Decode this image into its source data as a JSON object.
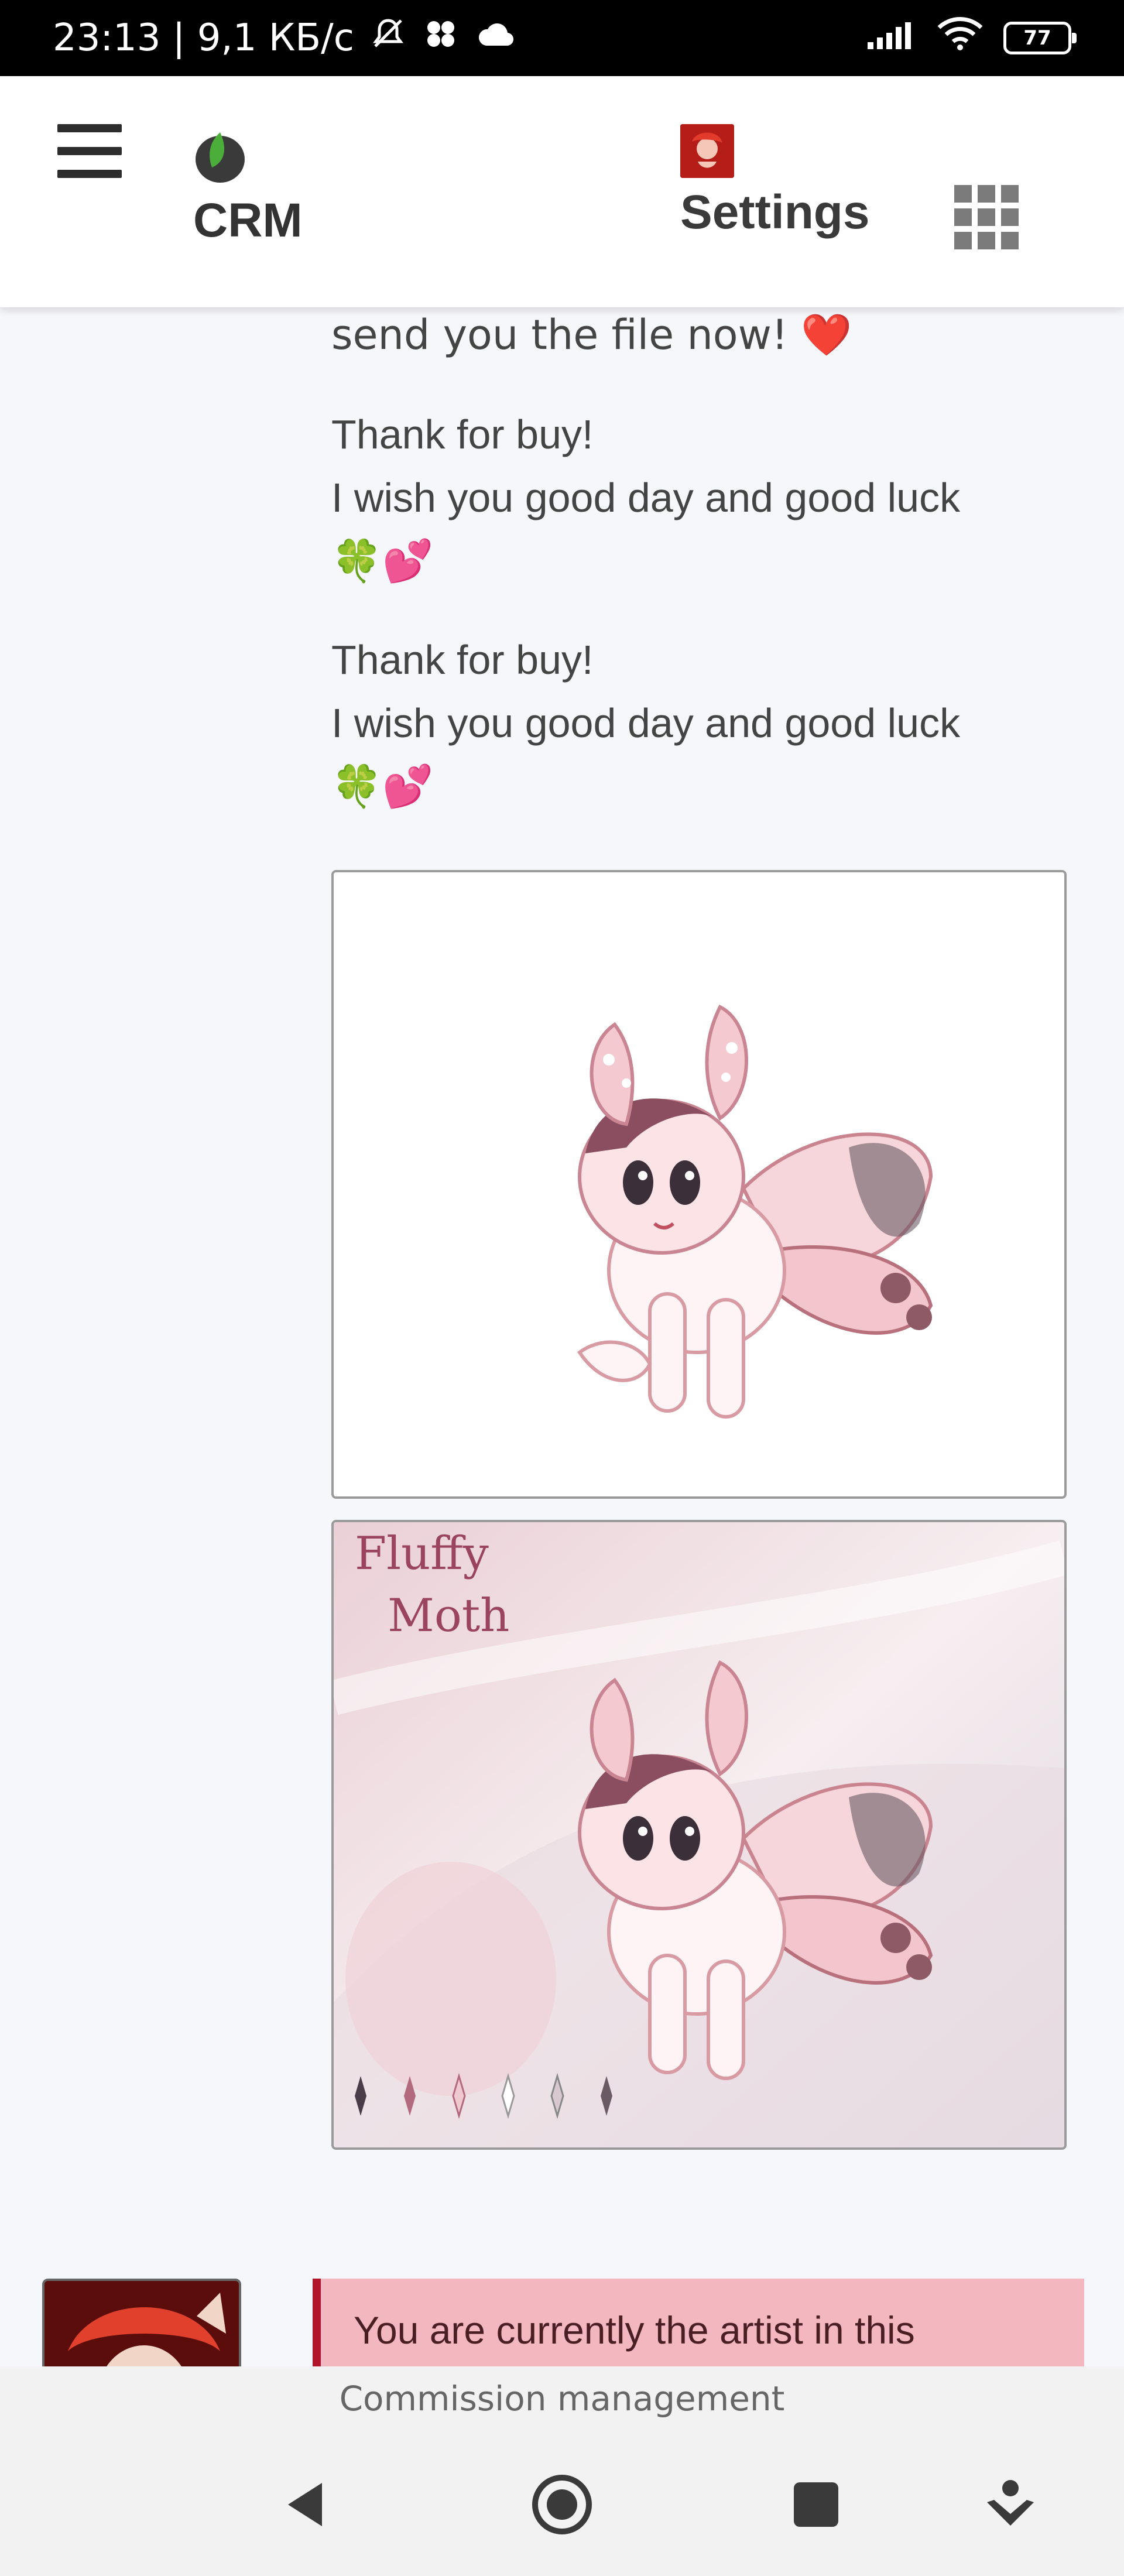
{
  "status_bar": {
    "time_speed": "23:13 | 9,1 КБ/с",
    "battery": "77"
  },
  "header": {
    "app_name": "CRM",
    "settings_label": "Settings"
  },
  "messages": [
    {
      "lines": [
        "send you the file now! ❤️"
      ]
    },
    {
      "lines": [
        "Thank for buy!",
        "I wish you good day and good luck",
        "🍀💕"
      ]
    },
    {
      "lines": [
        "Thank for buy!",
        "I wish you good day and good luck",
        "🍀💕"
      ]
    }
  ],
  "images": {
    "second_card_title_line1": "Fluffy",
    "second_card_title_line2": "Moth"
  },
  "notice": {
    "text": "You are currently the artist in this"
  },
  "bottom": {
    "caption": "Commission management"
  },
  "icons": {
    "status": [
      "mute-icon",
      "cloud-icon",
      "signal-icon",
      "wifi-icon",
      "battery-icon"
    ],
    "header": [
      "menu-icon",
      "leaf-logo-icon",
      "apps-grid-icon"
    ],
    "nav": [
      "back-icon",
      "home-icon",
      "recents-icon",
      "assistant-icon"
    ]
  },
  "colors": {
    "accent_notice": "#b0152a",
    "notice_bg": "#f3b8bf"
  }
}
